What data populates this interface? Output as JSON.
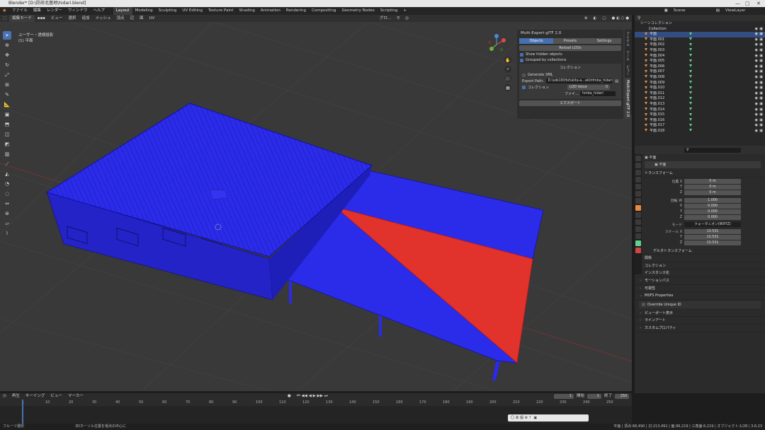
{
  "window": {
    "title": "Blender* [D:\\防府北基地\\hidari.blend]",
    "controls": [
      "—",
      "▢",
      "✕"
    ]
  },
  "menu": {
    "items": [
      "ファイル",
      "編集",
      "レンダー",
      "ウィンドウ",
      "ヘルプ"
    ],
    "workspaces": [
      "Layout",
      "Modeling",
      "Sculpting",
      "UV Editing",
      "Texture Paint",
      "Shading",
      "Animation",
      "Rendering",
      "Compositing",
      "Geometry Nodes",
      "Scripting"
    ],
    "active_workspace": "Layout",
    "scene_label": "Scene",
    "viewlayer_label": "ViewLayer"
  },
  "viewport_header": {
    "mode": "編集モード",
    "items": [
      "ビュー",
      "選択",
      "追加",
      "メッシュ",
      "頂点",
      "辺",
      "面",
      "UV"
    ],
    "transform_orientation": "グロ...",
    "overlay_label": "オプション"
  },
  "viewport": {
    "view_name": "ユーザー・透視投影",
    "object_name": "(1) 平面"
  },
  "toolbar": {
    "tools": [
      "cursor-select-icon",
      "cursor-icon",
      "move-icon",
      "rotate-icon",
      "scale-icon",
      "transform-icon",
      "annotate-icon",
      "measure-icon",
      "add-cube-icon",
      "extrude-icon",
      "inset-icon",
      "bevel-icon",
      "loop-cut-icon",
      "knife-icon",
      "poly-build-icon",
      "spin-icon",
      "smooth-icon",
      "edge-slide-icon",
      "shrink-icon",
      "shear-icon",
      "rip-icon"
    ]
  },
  "npanel": {
    "title": "Multi-Export glTF 2.0",
    "tabs": [
      "Objects",
      "Presets",
      "Settings"
    ],
    "active_tab": "Objects",
    "reload_label": "Reload LODs",
    "show_hidden_label": "Show hidden objects",
    "grouped_label": "Grouped by collections",
    "collection_header": "コレクション",
    "generate_xml_label": "Generate XML",
    "export_path_label": "Export Path:",
    "export_path_value": "D:\\sdk16\\Hofukita-a...ek\\hfmba_hidari",
    "collection_row_label": "コレクション",
    "lod_value_label": "LOD Value",
    "lod_value": "0",
    "file_label": "ファイ...",
    "file_value": "hmba_hidari",
    "export_button": "エクスポート",
    "side_tabs": [
      "アイテム",
      "ツール",
      "ビュー",
      "Multi-Export glTF 2.0"
    ]
  },
  "outliner": {
    "root": "シーンコレクション",
    "collection": "Collection",
    "items": [
      "平面",
      "平面.001",
      "平面.002",
      "平面.003",
      "平面.004",
      "平面.005",
      "平面.006",
      "平面.007",
      "平面.008",
      "平面.009",
      "平面.010",
      "平面.011",
      "平面.012",
      "平面.013",
      "平面.014",
      "平面.015",
      "平面.016",
      "平面.017",
      "平面.018"
    ],
    "selected": "平面"
  },
  "properties": {
    "object_name": "平面",
    "data_name": "平面",
    "transform_header": "トランスフォーム",
    "location": {
      "label": "位置 X",
      "x": "0 m",
      "y": "0 m",
      "z": "0 m"
    },
    "rotation": {
      "label": "回転 W",
      "w": "1.000",
      "x": "0.000",
      "y": "0.000",
      "z": "0.000"
    },
    "mode": {
      "label": "モード",
      "value": "クォータニオン(WXYZ)"
    },
    "scale": {
      "label": "スケール X",
      "x": "13.531",
      "y": "13.531",
      "z": "13.531"
    },
    "axis_labels": {
      "y": "Y",
      "z": "Z",
      "x": "X"
    },
    "delta_label": "デルタトランスフォーム",
    "sections": [
      "関係",
      "コレクション",
      "インスタンス化",
      "モーションパス",
      "可視性",
      "MSFS Properties"
    ],
    "override_label": "Override Unique ID",
    "bottom_sections": [
      "ビューポート表示",
      "ラインアート",
      "カスタムプロパティ"
    ]
  },
  "timeline": {
    "menus": [
      "再生",
      "キーイング",
      "ビュー",
      "マーカー"
    ],
    "current_frame": "1",
    "start_label": "開始",
    "start": "1",
    "end_label": "終了",
    "end": "250",
    "ticks": [
      "1",
      "10",
      "20",
      "30",
      "40",
      "50",
      "60",
      "70",
      "80",
      "90",
      "100",
      "110",
      "120",
      "130",
      "140",
      "150",
      "160",
      "170",
      "180",
      "190",
      "200",
      "210",
      "220",
      "230",
      "240",
      "250"
    ]
  },
  "status": {
    "left": "フルーツ選択",
    "middle": "3Dカーソル位置を視点の中心に",
    "right": "平面 | 頂点:68,490 | 辺:213,491 | 面:96,219 | 三角面:6,219 | オブジェクト:1/28 | 3.6.23"
  },
  "colors": {
    "accent": "#4772b3",
    "mesh": "#2a2aea",
    "face_selected": "#e1322b"
  }
}
